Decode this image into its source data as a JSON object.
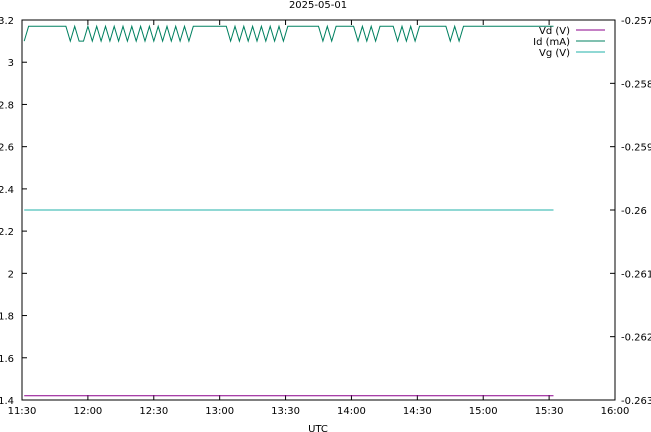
{
  "chart_data": {
    "type": "line",
    "title": "2025-05-01",
    "xlabel": "UTC",
    "ylabel_left": "",
    "ylabel_right": "",
    "x_ticks": [
      "11:30",
      "12:00",
      "12:30",
      "13:00",
      "13:30",
      "14:00",
      "14:30",
      "15:00",
      "15:30",
      "16:00"
    ],
    "x_range": [
      "11:30",
      "16:00"
    ],
    "y_left_ticks": [
      "1.4",
      "1.6",
      "1.8",
      "2",
      "2.2",
      "2.4",
      "2.6",
      "2.8",
      "3",
      "3.2"
    ],
    "y_left_range": [
      1.4,
      3.2
    ],
    "y_right_ticks": [
      "-0.257",
      "-0.258",
      "-0.259",
      "-0.26",
      "-0.261",
      "-0.262",
      "-0.263"
    ],
    "y_right_range": [
      -0.263,
      -0.257
    ],
    "grid": false,
    "legend_position": "top-right",
    "series": [
      {
        "name": "Vd (V)",
        "color": "#8b008b",
        "axis": "left",
        "x": [
          "11:31",
          "15:32"
        ],
        "values": [
          1.42,
          1.42
        ]
      },
      {
        "name": "Id (mA)",
        "color": "#008060",
        "axis": "left",
        "x": [
          "11:31",
          "11:33",
          "11:50",
          "11:52",
          "11:54",
          "11:56",
          "11:58",
          "12:00",
          "12:02",
          "12:04",
          "12:06",
          "12:08",
          "12:10",
          "12:12",
          "12:14",
          "12:16",
          "12:18",
          "12:20",
          "12:22",
          "12:24",
          "12:26",
          "12:28",
          "12:30",
          "12:32",
          "12:34",
          "12:36",
          "12:38",
          "12:40",
          "12:42",
          "12:44",
          "12:46",
          "12:48",
          "12:50",
          "13:03",
          "13:05",
          "13:07",
          "13:09",
          "13:11",
          "13:13",
          "13:15",
          "13:17",
          "13:19",
          "13:21",
          "13:23",
          "13:25",
          "13:27",
          "13:29",
          "13:31",
          "13:33",
          "13:45",
          "13:47",
          "13:49",
          "13:51",
          "13:53",
          "13:55",
          "14:01",
          "14:03",
          "14:05",
          "14:07",
          "14:09",
          "14:11",
          "14:13",
          "14:15",
          "14:19",
          "14:21",
          "14:23",
          "14:25",
          "14:27",
          "14:29",
          "14:31",
          "14:33",
          "14:43",
          "14:45",
          "14:47",
          "14:49",
          "14:51",
          "14:53",
          "15:32"
        ],
        "values": [
          3.1,
          3.17,
          3.17,
          3.1,
          3.17,
          3.1,
          3.1,
          3.17,
          3.1,
          3.17,
          3.1,
          3.17,
          3.1,
          3.17,
          3.1,
          3.17,
          3.1,
          3.17,
          3.1,
          3.17,
          3.1,
          3.17,
          3.1,
          3.17,
          3.1,
          3.17,
          3.1,
          3.17,
          3.1,
          3.17,
          3.1,
          3.17,
          3.17,
          3.17,
          3.1,
          3.17,
          3.1,
          3.17,
          3.1,
          3.17,
          3.1,
          3.17,
          3.1,
          3.17,
          3.1,
          3.17,
          3.1,
          3.17,
          3.17,
          3.17,
          3.1,
          3.17,
          3.1,
          3.17,
          3.17,
          3.17,
          3.1,
          3.17,
          3.1,
          3.17,
          3.1,
          3.17,
          3.17,
          3.17,
          3.1,
          3.17,
          3.1,
          3.17,
          3.1,
          3.17,
          3.17,
          3.17,
          3.1,
          3.17,
          3.1,
          3.17,
          3.17,
          3.17
        ]
      },
      {
        "name": "Vg (V)",
        "color": "#20b2aa",
        "axis": "right",
        "x": [
          "11:31",
          "15:32"
        ],
        "values": [
          -0.26,
          -0.26
        ]
      }
    ]
  }
}
